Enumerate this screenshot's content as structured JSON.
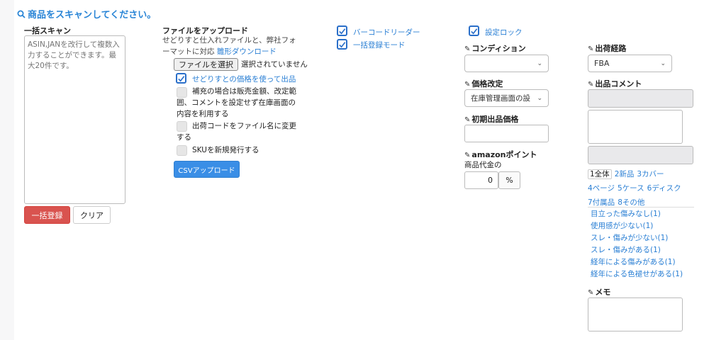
{
  "title": "商品をスキャンしてください。",
  "bulk_scan": {
    "label": "一括スキャン",
    "placeholder": "ASIN,JANを改行して複数入力することができます。最大20件です。",
    "register_button": "一括登録",
    "clear_button": "クリア"
  },
  "upload": {
    "label": "ファイルをアップロード",
    "desc_line1": "せどりすと仕入れファイルと、弊社フォ",
    "desc_line2": "ーマットに対応",
    "template_link": "雛形ダウンロード",
    "choose_file": "ファイルを選択",
    "no_file": "選択されていません",
    "opt_price": "せどりすとの価格を使って出品",
    "opt_supplement_1": "補充の場合は販売金額、改定範",
    "opt_supplement_2": "囲、コメントを設定せず在庫画面の",
    "opt_supplement_3": "内容を利用する",
    "opt_shipcode_1": "出荷コードをファイル名に変更",
    "opt_shipcode_2": "する",
    "opt_sku": "SKUを新規発行する",
    "csv_button": "CSVアップロード"
  },
  "modes": {
    "barcode_reader": "バーコードリーダー",
    "bulk_mode": "一括登録モード",
    "setting_lock": "設定ロック"
  },
  "fields": {
    "condition_label": "コンディション",
    "condition_value": "",
    "price_revision_label": "価格改定",
    "price_revision_value": "在庫管理画面の設",
    "initial_price_label": "初期出品価格",
    "amazon_point_label": "amazonポイント",
    "product_amount_label": "商品代金の",
    "point_value": "0",
    "percent_sign": "%"
  },
  "shipping": {
    "route_label": "出荷経路",
    "route_value": "FBA",
    "comment_label": "出品コメント",
    "tabs": [
      "1全体",
      "2新品",
      "3カバー",
      "4ページ",
      "5ケース",
      "6ディスク",
      "7付属品",
      "8その他"
    ],
    "conditions": [
      "目立った傷みなし(1)",
      "使用感が少ない(1)",
      "スレ・傷みが少ない(1)",
      "スレ・傷みがある(1)",
      "経年による傷みがある(1)",
      "経年による色褪せがある(1)"
    ],
    "memo_label": "メモ"
  },
  "colors": {
    "accent": "#2a85d6",
    "danger": "#d9534f",
    "primary": "#3a8ee6"
  },
  "icons": [
    "search-icon",
    "tag-icon",
    "checkbox-checked-icon",
    "chevron-down-icon",
    "resize-grip-icon"
  ]
}
